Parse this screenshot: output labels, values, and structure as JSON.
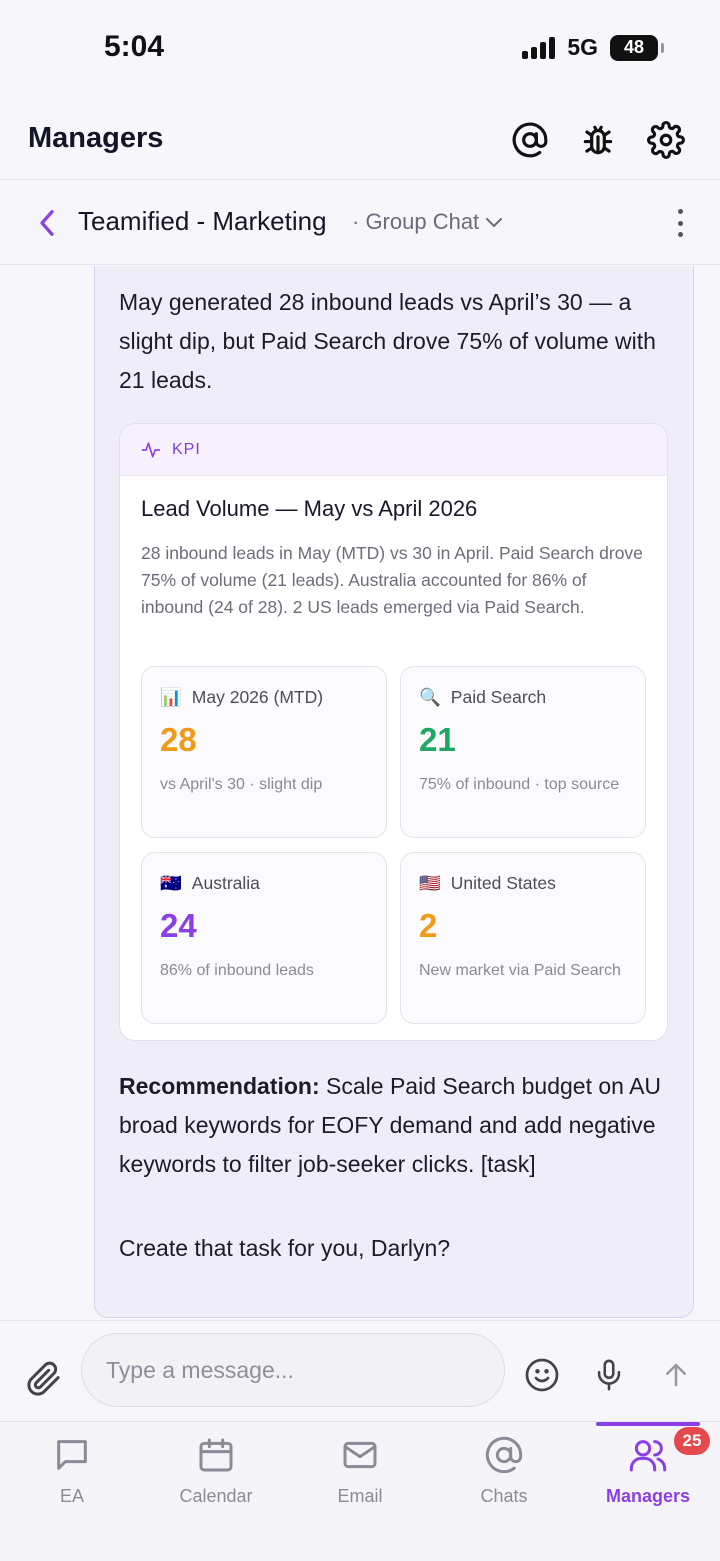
{
  "status_bar": {
    "time": "5:04",
    "network": "5G",
    "battery": "48"
  },
  "header": {
    "title": "Managers",
    "icons": [
      "at-sign-icon",
      "bug-icon",
      "gear-icon"
    ]
  },
  "chat": {
    "title": "Teamified - Marketing",
    "subtitle": "· Group Chat"
  },
  "message": {
    "intro": "May generated 28 inbound leads vs April’s 30 — a slight dip, but Paid Search drove 75% of volume with 21 leads.",
    "kpi": {
      "tag": "KPI",
      "title": "Lead Volume — May vs April 2026",
      "description": "28 inbound leads in May (MTD) vs 30 in April. Paid Search drove 75% of volume (21 leads). Australia accounted for 86% of inbound (24 of 28). 2 US leads emerged via Paid Search.",
      "tiles": [
        {
          "emoji": "📊",
          "label": "May 2026 (MTD)",
          "value": "28",
          "note": "vs April's 30 · slight dip",
          "color": "#f09a1a"
        },
        {
          "emoji": "🔍",
          "label": "Paid Search",
          "value": "21",
          "note": "75% of inbound · top source",
          "color": "#1fa764"
        },
        {
          "emoji": "🇦🇺",
          "label": "Australia",
          "value": "24",
          "note": "86% of inbound leads",
          "color": "#8b3fe6"
        },
        {
          "emoji": "🇺🇸",
          "label": "United States",
          "value": "2",
          "note": "New market via Paid Search",
          "color": "#f09a1a"
        }
      ]
    },
    "recommendation_label": "Recommendation:",
    "recommendation_text": " Scale Paid Search budget on AU broad keywords for EOFY demand and add negative keywords to filter job-seeker clicks. [task]",
    "ask": "Create that task for you, Darlyn?"
  },
  "composer": {
    "placeholder": "Type a message..."
  },
  "tabs": [
    {
      "label": "EA",
      "icon": "chat-bubble-icon"
    },
    {
      "label": "Calendar",
      "icon": "calendar-icon"
    },
    {
      "label": "Email",
      "icon": "mail-icon"
    },
    {
      "label": "Chats",
      "icon": "at-sign-icon"
    },
    {
      "label": "Managers",
      "icon": "users-icon",
      "badge": "25",
      "active": true
    }
  ],
  "colors": {
    "accent": "#8b3fe6",
    "badge": "#e5484d"
  }
}
